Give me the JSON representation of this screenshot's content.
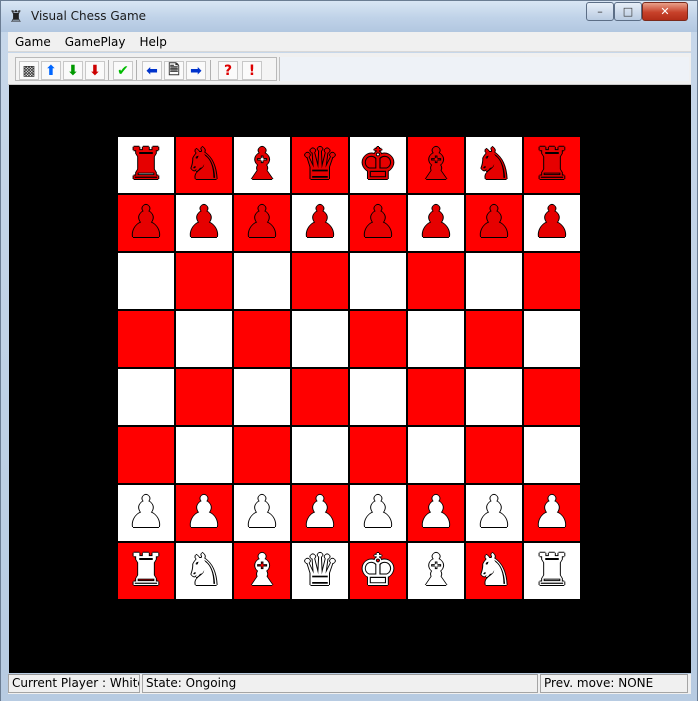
{
  "window": {
    "title": "Visual Chess Game",
    "app_icon": "chess-rook-icon",
    "controls": {
      "minimize": "–",
      "maximize": "□",
      "close": "✕"
    }
  },
  "menu": {
    "items": [
      "Game",
      "GamePlay",
      "Help"
    ]
  },
  "toolbar": {
    "buttons": [
      {
        "icon": "board-pattern-icon",
        "glyph": "▩",
        "color": "#333333"
      },
      {
        "icon": "arrow-up-icon",
        "glyph": "⬆",
        "color": "#0066ff"
      },
      {
        "icon": "arrow-down-green-icon",
        "glyph": "⬇",
        "color": "#009900"
      },
      {
        "icon": "arrow-down-red-icon",
        "glyph": "⬇",
        "color": "#cc0000"
      },
      {
        "icon": "checkmark-icon",
        "glyph": "✔",
        "color": "#00bb00"
      },
      {
        "icon": "arrow-left-icon",
        "glyph": "⬅",
        "color": "#0033cc"
      },
      {
        "icon": "document-icon",
        "glyph": "🗎",
        "color": "#333333"
      },
      {
        "icon": "arrow-right-icon",
        "glyph": "➡",
        "color": "#0033cc"
      },
      {
        "icon": "question-icon",
        "glyph": "?",
        "color": "#dd0000"
      },
      {
        "icon": "exclamation-icon",
        "glyph": "!",
        "color": "#dd0000"
      }
    ]
  },
  "board": {
    "light_color": "#ffffff",
    "dark_color": "#ff0000",
    "ranks": [
      [
        "bR",
        "bN",
        "bB",
        "bQ",
        "bK",
        "bB",
        "bN",
        "bR"
      ],
      [
        "bP",
        "bP",
        "bP",
        "bP",
        "bP",
        "bP",
        "bP",
        "bP"
      ],
      [
        "",
        "",
        "",
        "",
        "",
        "",
        "",
        ""
      ],
      [
        "",
        "",
        "",
        "",
        "",
        "",
        "",
        ""
      ],
      [
        "",
        "",
        "",
        "",
        "",
        "",
        "",
        ""
      ],
      [
        "",
        "",
        "",
        "",
        "",
        "",
        "",
        ""
      ],
      [
        "wP",
        "wP",
        "wP",
        "wP",
        "wP",
        "wP",
        "wP",
        "wP"
      ],
      [
        "wR",
        "wN",
        "wB",
        "wQ",
        "wK",
        "wB",
        "wN",
        "wR"
      ]
    ]
  },
  "status": {
    "player": "Current Player : White",
    "state": "State: Ongoing",
    "prev_move": "Prev. move: NONE"
  }
}
